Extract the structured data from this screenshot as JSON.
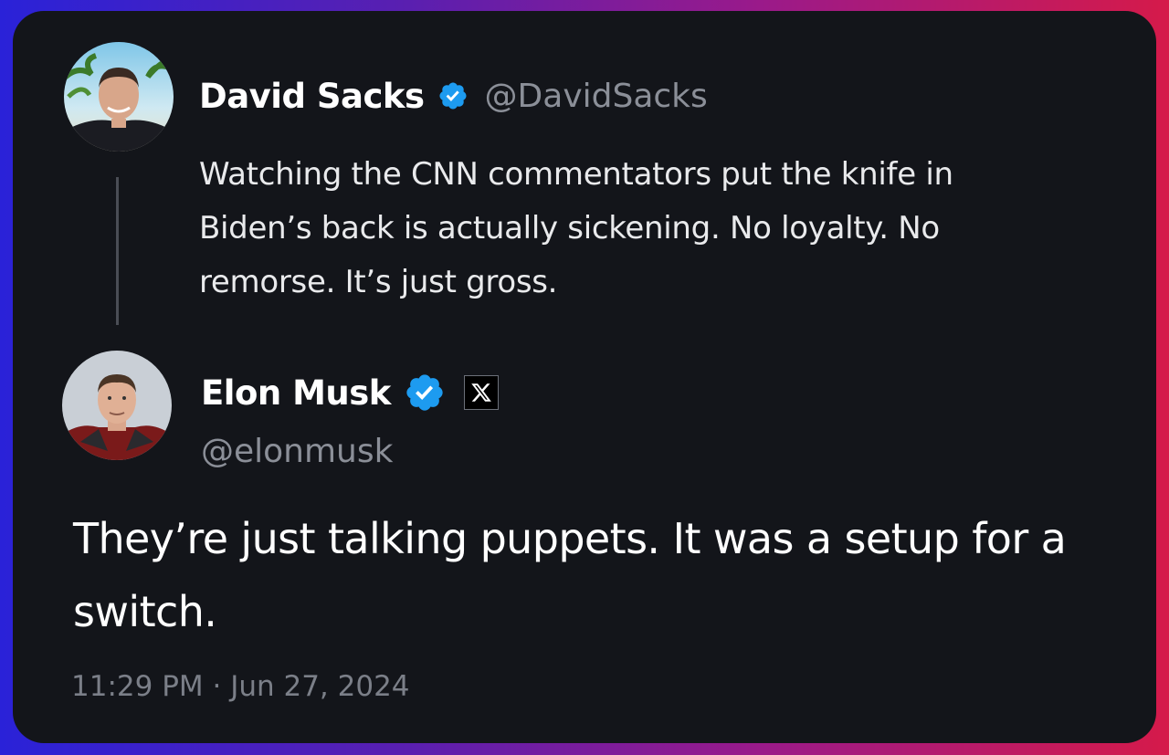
{
  "parent_tweet": {
    "author_name": "David Sacks",
    "author_handle": "@DavidSacks",
    "verified": true,
    "text": "Watching the CNN commentators put the knife in Biden’s back is actually sickening. No loyalty. No remorse. It’s just gross."
  },
  "main_tweet": {
    "author_name": "Elon Musk",
    "author_handle": "@elonmusk",
    "verified": true,
    "affiliate_badge_icon": "x-logo-icon",
    "text": "They’re just talking puppets. It was a setup for a switch.",
    "timestamp": "11:29 PM · Jun 27, 2024"
  },
  "colors": {
    "verified_blue": "#1d9bf0",
    "card_background": "#13151a",
    "secondary_text": "#8b8f98"
  }
}
